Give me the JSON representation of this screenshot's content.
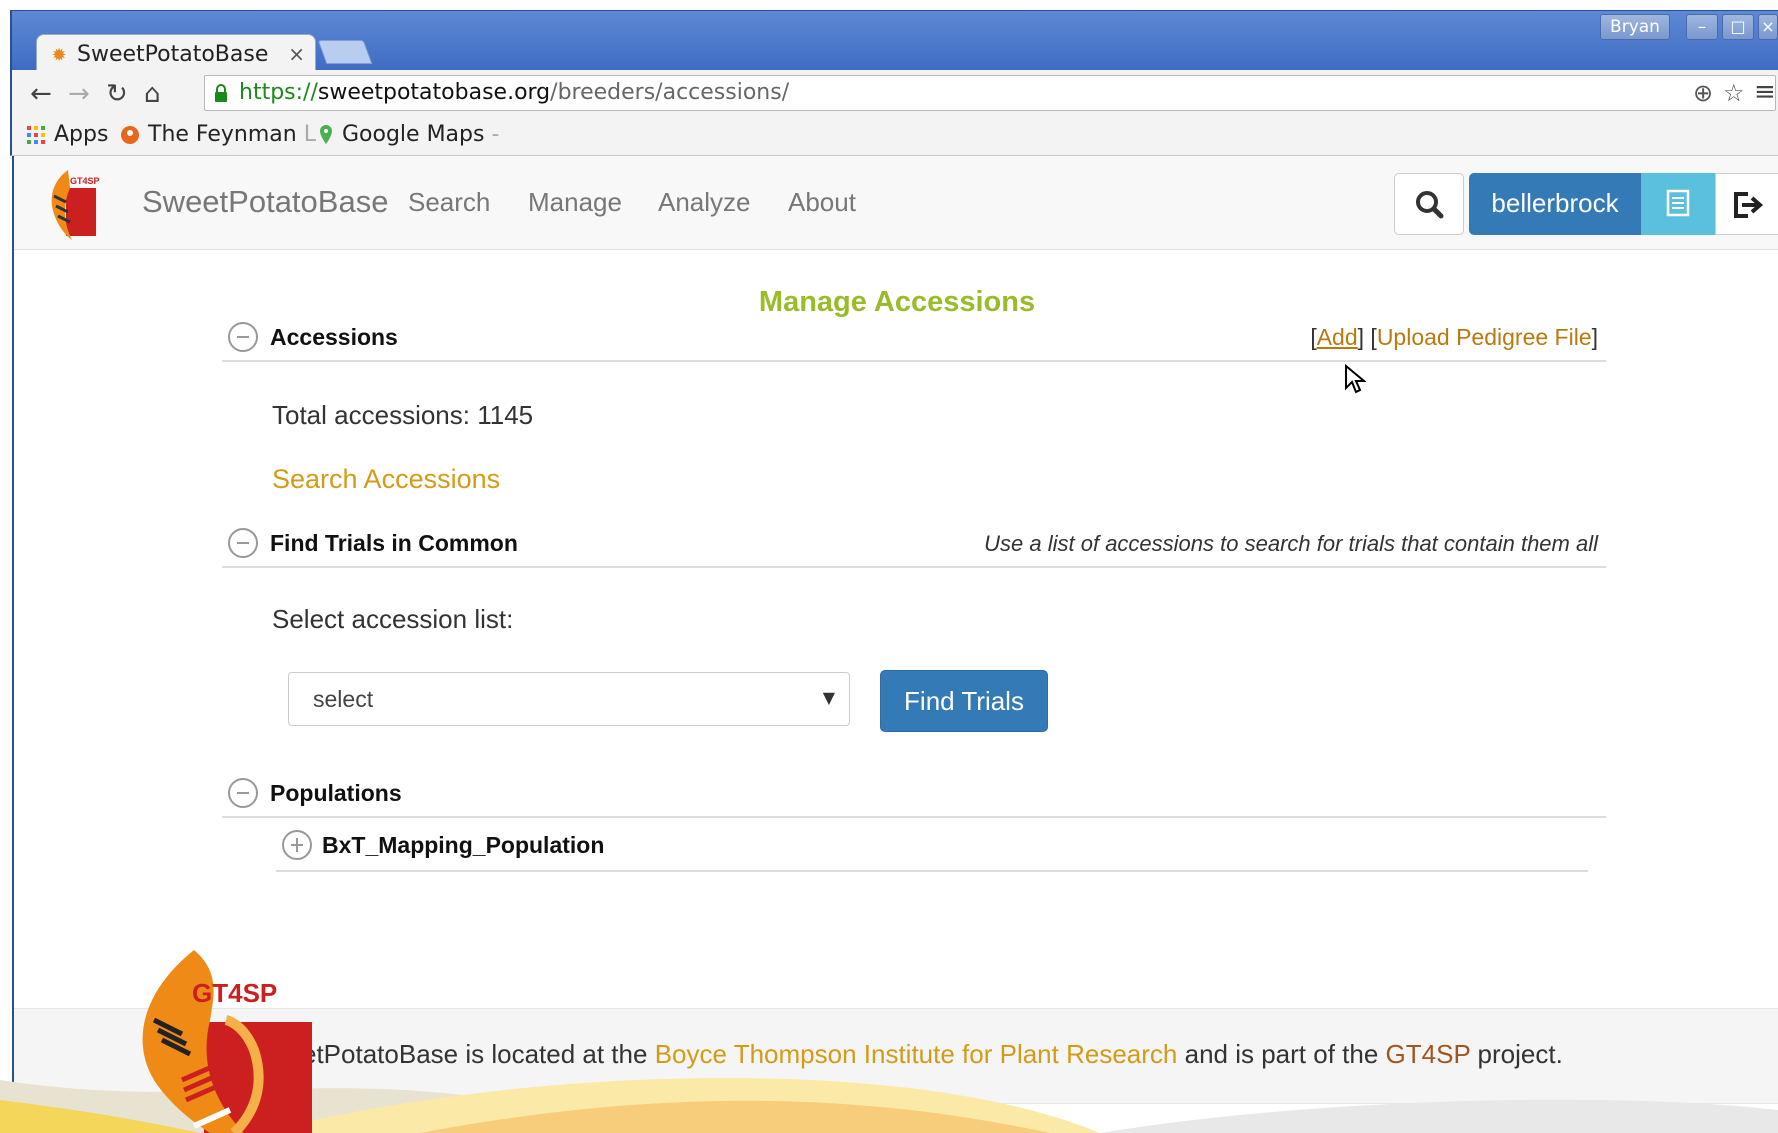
{
  "browser": {
    "tab_title": "SweetPotatoBase",
    "tab_close": "×",
    "window_user": "Bryan",
    "url_scheme": "https://",
    "url_host": "sweetpotatobase.org",
    "url_path": "/breeders/accessions/",
    "bookmarks": [
      {
        "label": "Apps",
        "icon": "apps-grid-icon"
      },
      {
        "label": "The Feynman",
        "faded": "L",
        "icon": "feynman-icon"
      },
      {
        "label": "Google Maps",
        "faded": "-",
        "icon": "maps-pin-icon"
      }
    ]
  },
  "navbar": {
    "brand": "SweetPotatoBase",
    "links": [
      "Search",
      "Manage",
      "Analyze",
      "About"
    ],
    "username": "bellerbrock"
  },
  "page": {
    "title": "Manage Accessions"
  },
  "accessions": {
    "title": "Accessions",
    "add_label": "Add",
    "upload_label": "Upload Pedigree File",
    "total": "Total accessions: 1145",
    "search_link": "Search Accessions"
  },
  "trials": {
    "title": "Find Trials in Common",
    "note": "Use a list of accessions to search for trials that contain them all",
    "select_label": "Select accession list:",
    "select_value": "select",
    "button": "Find Trials"
  },
  "populations": {
    "title": "Populations",
    "items": [
      "BxT_Mapping_Population"
    ]
  },
  "footer": {
    "text_a": "etPotatoBase is located at the",
    "link_bti": "Boyce Thompson Institute for Plant Research",
    "text_b": "and is part of the",
    "link_gt4sp": "GT4SP",
    "text_c": "project.",
    "logo_text": "GT4SP"
  },
  "colors": {
    "title_green": "#9abb2a",
    "link_orange": "#d49b16",
    "primary_blue": "#337ab7",
    "info_cyan": "#5bc0de"
  }
}
